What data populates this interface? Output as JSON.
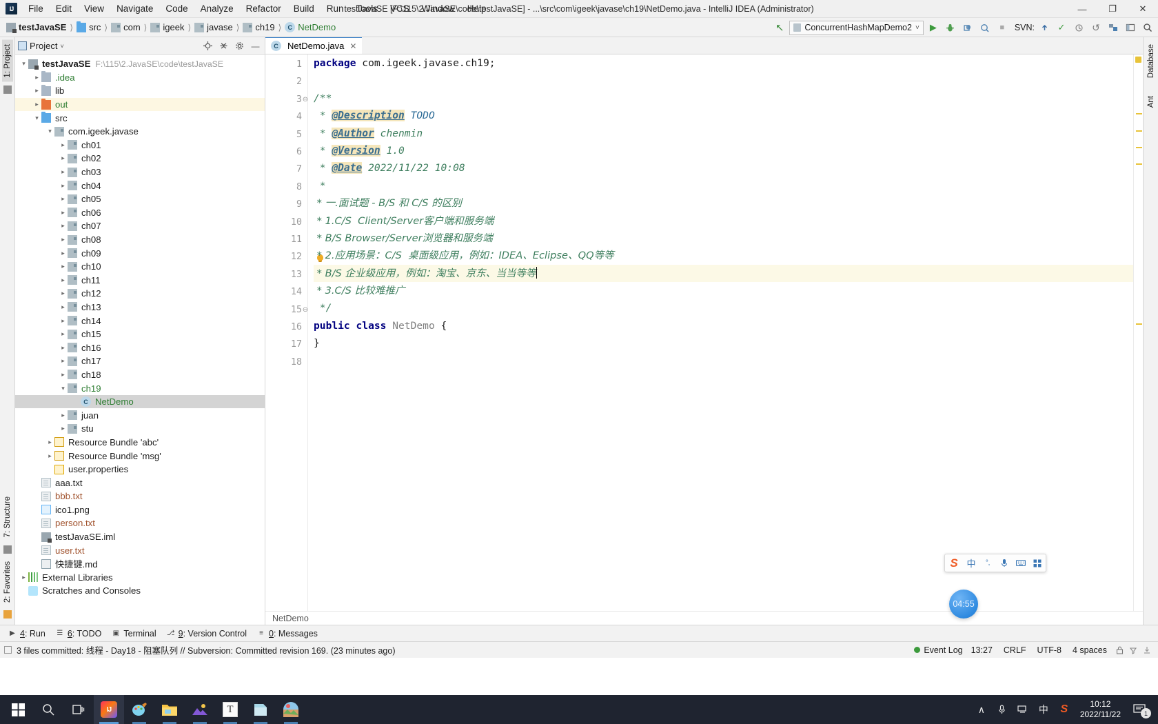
{
  "window": {
    "title": "testJavaSE [F:\\115\\2.JavaSE\\code\\testJavaSE] - ...\\src\\com\\igeek\\javase\\ch19\\NetDemo.java - IntelliJ IDEA (Administrator)",
    "logo": "IJ",
    "minimize": "—",
    "maximize": "❐",
    "close": "✕"
  },
  "menu": [
    {
      "label": "File"
    },
    {
      "label": "Edit"
    },
    {
      "label": "View"
    },
    {
      "label": "Navigate"
    },
    {
      "label": "Code"
    },
    {
      "label": "Analyze"
    },
    {
      "label": "Refactor"
    },
    {
      "label": "Build"
    },
    {
      "label": "Run"
    },
    {
      "label": "Tools"
    },
    {
      "label": "VCS"
    },
    {
      "label": "Window"
    },
    {
      "label": "Help"
    }
  ],
  "breadcrumbs": [
    {
      "label": "testJavaSE",
      "icon": "module-icon",
      "style": "bold"
    },
    {
      "label": "src",
      "icon": "folder-blue-icon",
      "style": "normal"
    },
    {
      "label": "com",
      "icon": "package-icon",
      "style": "normal"
    },
    {
      "label": "igeek",
      "icon": "package-icon",
      "style": "normal"
    },
    {
      "label": "javase",
      "icon": "package-icon",
      "style": "normal"
    },
    {
      "label": "ch19",
      "icon": "package-icon",
      "style": "normal"
    },
    {
      "label": "NetDemo",
      "icon": "class-icon",
      "style": "green"
    }
  ],
  "toolbar": {
    "back_arrow": "↖",
    "run_config": "ConcurrentHashMapDemo2",
    "run_config_caret": "˅",
    "run": "▶",
    "debug": "debug-icon",
    "run_coverage": "coverage-icon",
    "profile": "profile-icon",
    "stop": "■",
    "svn_label": "SVN:",
    "svn_update": "update-icon",
    "svn_commit": "✓",
    "svn_history": "history-icon",
    "svn_rollback": "↺",
    "settings": "settings-icon",
    "layout": "layout-icon",
    "search": "search-icon"
  },
  "left_rail": {
    "top": "1: Project",
    "bottom": [
      "7: Structure",
      "2: Favorites"
    ],
    "star_icon": "star-icon"
  },
  "right_rail": {
    "items": [
      "Database",
      "Ant"
    ]
  },
  "project_panel": {
    "title": "Project",
    "caret": "˅",
    "locate_icon": "locate-icon",
    "collapse_icon": "collapse-all-icon",
    "gear_icon": "gear-icon",
    "hide_icon": "hide-icon",
    "tree": [
      {
        "depth": 0,
        "arrow": "open",
        "icon": "module-icon",
        "label": "testJavaSE",
        "bold": true,
        "path": "F:\\115\\2.JavaSE\\code\\testJavaSE",
        "color": "black",
        "state": "none"
      },
      {
        "depth": 1,
        "arrow": "closed",
        "icon": "folder-icon",
        "label": ".idea",
        "color": "green",
        "state": "none"
      },
      {
        "depth": 1,
        "arrow": "closed",
        "icon": "folder-icon",
        "label": "lib",
        "color": "black",
        "state": "none"
      },
      {
        "depth": 1,
        "arrow": "closed",
        "icon": "folder-orange-icon",
        "label": "out",
        "color": "green",
        "state": "highlight"
      },
      {
        "depth": 1,
        "arrow": "open",
        "icon": "folder-blue-icon",
        "label": "src",
        "color": "black",
        "state": "none"
      },
      {
        "depth": 2,
        "arrow": "open",
        "icon": "package-icon",
        "label": "com.igeek.javase",
        "color": "black",
        "state": "none"
      },
      {
        "depth": 3,
        "arrow": "closed",
        "icon": "package-icon",
        "label": "ch01",
        "color": "black",
        "state": "none"
      },
      {
        "depth": 3,
        "arrow": "closed",
        "icon": "package-icon",
        "label": "ch02",
        "color": "black",
        "state": "none"
      },
      {
        "depth": 3,
        "arrow": "closed",
        "icon": "package-icon",
        "label": "ch03",
        "color": "black",
        "state": "none"
      },
      {
        "depth": 3,
        "arrow": "closed",
        "icon": "package-icon",
        "label": "ch04",
        "color": "black",
        "state": "none"
      },
      {
        "depth": 3,
        "arrow": "closed",
        "icon": "package-icon",
        "label": "ch05",
        "color": "black",
        "state": "none"
      },
      {
        "depth": 3,
        "arrow": "closed",
        "icon": "package-icon",
        "label": "ch06",
        "color": "black",
        "state": "none"
      },
      {
        "depth": 3,
        "arrow": "closed",
        "icon": "package-icon",
        "label": "ch07",
        "color": "black",
        "state": "none"
      },
      {
        "depth": 3,
        "arrow": "closed",
        "icon": "package-icon",
        "label": "ch08",
        "color": "black",
        "state": "none"
      },
      {
        "depth": 3,
        "arrow": "closed",
        "icon": "package-icon",
        "label": "ch09",
        "color": "black",
        "state": "none"
      },
      {
        "depth": 3,
        "arrow": "closed",
        "icon": "package-icon",
        "label": "ch10",
        "color": "black",
        "state": "none"
      },
      {
        "depth": 3,
        "arrow": "closed",
        "icon": "package-icon",
        "label": "ch11",
        "color": "black",
        "state": "none"
      },
      {
        "depth": 3,
        "arrow": "closed",
        "icon": "package-icon",
        "label": "ch12",
        "color": "black",
        "state": "none"
      },
      {
        "depth": 3,
        "arrow": "closed",
        "icon": "package-icon",
        "label": "ch13",
        "color": "black",
        "state": "none"
      },
      {
        "depth": 3,
        "arrow": "closed",
        "icon": "package-icon",
        "label": "ch14",
        "color": "black",
        "state": "none"
      },
      {
        "depth": 3,
        "arrow": "closed",
        "icon": "package-icon",
        "label": "ch15",
        "color": "black",
        "state": "none"
      },
      {
        "depth": 3,
        "arrow": "closed",
        "icon": "package-icon",
        "label": "ch16",
        "color": "black",
        "state": "none"
      },
      {
        "depth": 3,
        "arrow": "closed",
        "icon": "package-icon",
        "label": "ch17",
        "color": "black",
        "state": "none"
      },
      {
        "depth": 3,
        "arrow": "closed",
        "icon": "package-icon",
        "label": "ch18",
        "color": "black",
        "state": "none"
      },
      {
        "depth": 3,
        "arrow": "open",
        "icon": "package-icon",
        "label": "ch19",
        "color": "green",
        "state": "none"
      },
      {
        "depth": 4,
        "arrow": "none",
        "icon": "class-icon",
        "label": "NetDemo",
        "color": "green",
        "state": "selected"
      },
      {
        "depth": 3,
        "arrow": "closed",
        "icon": "package-icon",
        "label": "juan",
        "color": "black",
        "state": "none"
      },
      {
        "depth": 3,
        "arrow": "closed",
        "icon": "package-icon",
        "label": "stu",
        "color": "black",
        "state": "none"
      },
      {
        "depth": 2,
        "arrow": "closed",
        "icon": "resource-bundle-icon",
        "label": "Resource Bundle 'abc'",
        "color": "black",
        "state": "none"
      },
      {
        "depth": 2,
        "arrow": "closed",
        "icon": "resource-bundle-icon",
        "label": "Resource Bundle 'msg'",
        "color": "black",
        "state": "none"
      },
      {
        "depth": 2,
        "arrow": "none",
        "icon": "properties-icon",
        "label": "user.properties",
        "color": "black",
        "state": "none"
      },
      {
        "depth": 1,
        "arrow": "none",
        "icon": "text-file-icon",
        "label": "aaa.txt",
        "color": "black",
        "state": "none"
      },
      {
        "depth": 1,
        "arrow": "none",
        "icon": "text-file-icon",
        "label": "bbb.txt",
        "color": "brown",
        "state": "none"
      },
      {
        "depth": 1,
        "arrow": "none",
        "icon": "image-file-icon",
        "label": "ico1.png",
        "color": "black",
        "state": "none"
      },
      {
        "depth": 1,
        "arrow": "none",
        "icon": "text-file-icon",
        "label": "person.txt",
        "color": "brown",
        "state": "none"
      },
      {
        "depth": 1,
        "arrow": "none",
        "icon": "iml-file-icon",
        "label": "testJavaSE.iml",
        "color": "black",
        "state": "none"
      },
      {
        "depth": 1,
        "arrow": "none",
        "icon": "text-file-icon",
        "label": "user.txt",
        "color": "brown",
        "state": "none"
      },
      {
        "depth": 1,
        "arrow": "none",
        "icon": "markdown-icon",
        "label": "快捷键.md",
        "color": "black",
        "state": "none"
      },
      {
        "depth": 0,
        "arrow": "closed",
        "icon": "libraries-icon",
        "label": "External Libraries",
        "color": "black",
        "state": "none"
      },
      {
        "depth": 0,
        "arrow": "none",
        "icon": "scratches-icon",
        "label": "Scratches and Consoles",
        "color": "black",
        "state": "none"
      }
    ]
  },
  "editor": {
    "tab": {
      "label": "NetDemo.java",
      "icon": "class-icon",
      "close": "✕"
    },
    "breadcrumb": "NetDemo",
    "line_count": 18,
    "current_line": 13,
    "lines": [
      {
        "n": 1,
        "fold": "",
        "bulb": false,
        "segments": [
          {
            "t": "package ",
            "c": "kw"
          },
          {
            "t": "com.igeek.javase.ch19;",
            "c": "plain"
          }
        ]
      },
      {
        "n": 2,
        "fold": "",
        "bulb": false,
        "segments": []
      },
      {
        "n": 3,
        "fold": "-",
        "bulb": false,
        "segments": [
          {
            "t": "/**",
            "c": "cmt"
          }
        ]
      },
      {
        "n": 4,
        "fold": "",
        "bulb": false,
        "segments": [
          {
            "t": " * ",
            "c": "cmt"
          },
          {
            "t": "@Description",
            "c": "tag"
          },
          {
            "t": " ",
            "c": "cmt"
          },
          {
            "t": "TODO",
            "c": "tagval"
          }
        ]
      },
      {
        "n": 5,
        "fold": "",
        "bulb": false,
        "segments": [
          {
            "t": " * ",
            "c": "cmt"
          },
          {
            "t": "@Author",
            "c": "tag"
          },
          {
            "t": " chenmin",
            "c": "cmt"
          }
        ]
      },
      {
        "n": 6,
        "fold": "",
        "bulb": false,
        "segments": [
          {
            "t": " * ",
            "c": "cmt"
          },
          {
            "t": "@Version",
            "c": "tag"
          },
          {
            "t": " 1.0",
            "c": "cmt"
          }
        ]
      },
      {
        "n": 7,
        "fold": "",
        "bulb": false,
        "segments": [
          {
            "t": " * ",
            "c": "cmt"
          },
          {
            "t": "@Date",
            "c": "tag"
          },
          {
            "t": " 2022/11/22 10:08",
            "c": "cmt"
          }
        ]
      },
      {
        "n": 8,
        "fold": "",
        "bulb": false,
        "segments": [
          {
            "t": " * ",
            "c": "cmt"
          }
        ]
      },
      {
        "n": 9,
        "fold": "",
        "bulb": false,
        "segments": [
          {
            "t": " * 一.面试题 - B/S 和 C/S 的区别",
            "c": "cmt"
          }
        ]
      },
      {
        "n": 10,
        "fold": "",
        "bulb": false,
        "segments": [
          {
            "t": " * 1.C/S  Client/Server客户端和服务端",
            "c": "cmt"
          }
        ]
      },
      {
        "n": 11,
        "fold": "",
        "bulb": false,
        "segments": [
          {
            "t": " * B/S Browser/Server浏览器和服务端",
            "c": "cmt"
          }
        ]
      },
      {
        "n": 12,
        "fold": "",
        "bulb": true,
        "segments": [
          {
            "t": " * 2.应用场景：C/S  桌面级应用，例如：IDEA、Eclipse、QQ等等",
            "c": "cmt"
          }
        ]
      },
      {
        "n": 13,
        "fold": "",
        "bulb": false,
        "segments": [
          {
            "t": " * B/S 企业级应用，例如：淘宝、京东、当当等等",
            "c": "cmt"
          }
        ],
        "caret": true
      },
      {
        "n": 14,
        "fold": "",
        "bulb": false,
        "segments": [
          {
            "t": " * 3.C/S 比较难推广",
            "c": "cmt"
          }
        ]
      },
      {
        "n": 15,
        "fold": "+",
        "bulb": false,
        "segments": [
          {
            "t": " */",
            "c": "cmt"
          }
        ]
      },
      {
        "n": 16,
        "fold": "",
        "bulb": false,
        "segments": [
          {
            "t": "public class ",
            "c": "kw"
          },
          {
            "t": "NetDemo ",
            "c": "cls"
          },
          {
            "t": "{",
            "c": "plain"
          }
        ]
      },
      {
        "n": 17,
        "fold": "",
        "bulb": false,
        "segments": [
          {
            "t": "}",
            "c": "plain"
          }
        ]
      },
      {
        "n": 18,
        "fold": "",
        "bulb": false,
        "segments": []
      }
    ]
  },
  "tool_windows": [
    {
      "num": "4",
      "label": "Run",
      "icon": "run-icon"
    },
    {
      "num": "6",
      "label": "TODO",
      "icon": "todo-icon"
    },
    {
      "num": "",
      "label": "Terminal",
      "icon": "terminal-icon"
    },
    {
      "num": "9",
      "label": "Version Control",
      "icon": "branch-icon"
    },
    {
      "num": "0",
      "label": "Messages",
      "icon": "messages-icon"
    }
  ],
  "status_bar": {
    "message": "3 files committed: 线程 - Day18 - 阻塞队列 // Subversion: Committed revision 169. (23 minutes ago)",
    "event_log": "Event Log",
    "position": "13:27",
    "line_separator": "CRLF",
    "encoding": "UTF-8",
    "indent": "4 spaces",
    "lock_icon": "lock-icon",
    "inspection_icon": "inspection-icon",
    "update_icon": "download-icon"
  },
  "timer_bubble": {
    "value": "04:55"
  },
  "ime": {
    "logo": "S",
    "mode": "中",
    "punctuation": "°‚",
    "mic_icon": "microphone-icon",
    "keyboard_icon": "keyboard-icon",
    "toolbox_icon": "toolbox-icon"
  },
  "taskbar": {
    "items": [
      {
        "name": "start-button",
        "glyph": "⊞"
      },
      {
        "name": "search-button",
        "glyph": "⌕"
      },
      {
        "name": "task-view-button",
        "glyph": "▣"
      },
      {
        "name": "intellij-idea",
        "glyph": "IJ",
        "state": "active"
      },
      {
        "name": "paint-app",
        "glyph": "🎨",
        "state": "running"
      },
      {
        "name": "file-explorer",
        "glyph": "🗂",
        "state": "running"
      },
      {
        "name": "photos-app",
        "glyph": "🏔",
        "state": "running"
      },
      {
        "name": "typora-app",
        "glyph": "T",
        "state": "running"
      },
      {
        "name": "notes-app",
        "glyph": "📘",
        "state": "running"
      },
      {
        "name": "picture-app",
        "glyph": "🖼",
        "state": "running"
      }
    ],
    "tray": {
      "chevron": "∧",
      "mic": "mic-icon",
      "network": "network-icon",
      "ime_mode": "中",
      "sogou": "S",
      "time": "10:12",
      "date": "2022/11/22",
      "notification_count": "1"
    }
  }
}
